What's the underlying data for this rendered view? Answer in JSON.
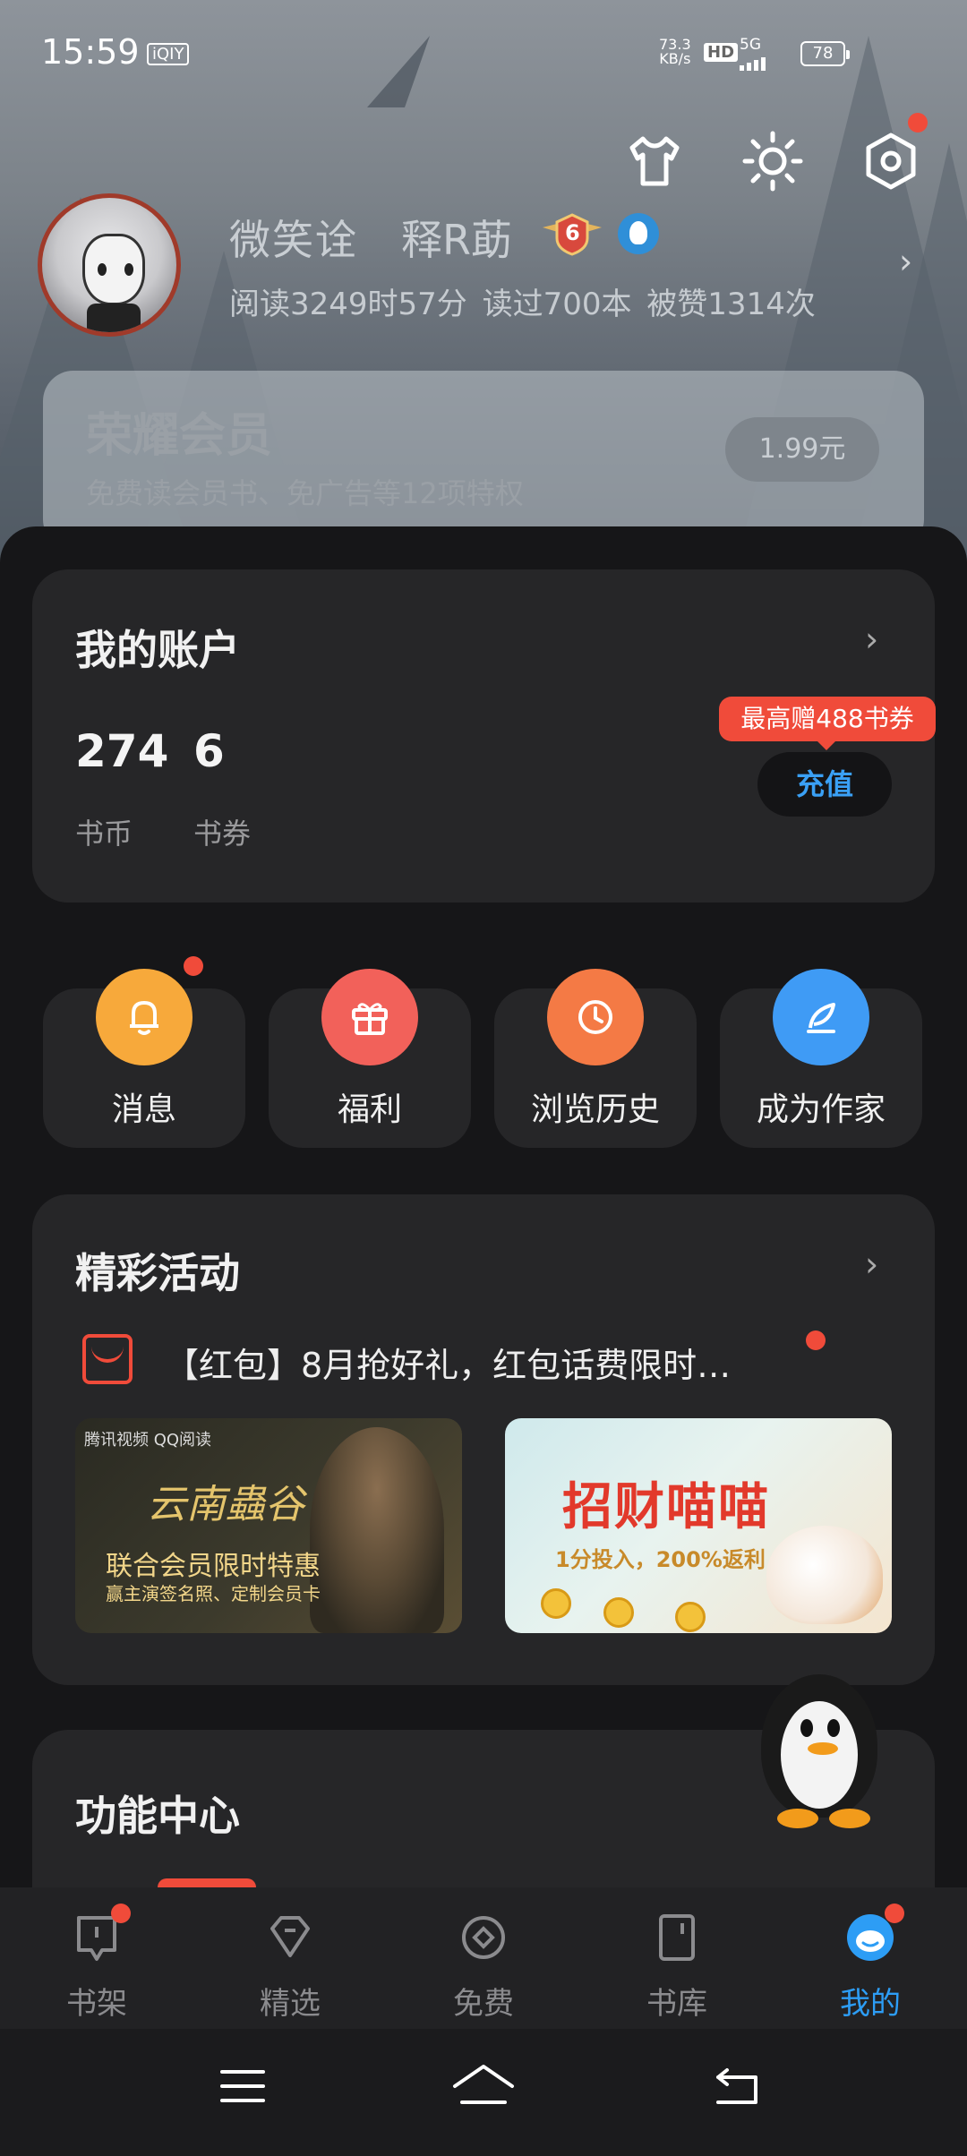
{
  "status_bar": {
    "time": "15:59",
    "app_tag": "iQIY",
    "net_speed": "73.3",
    "net_unit": "KB/s",
    "hd": "HD",
    "signal": "5G",
    "battery": "78"
  },
  "header_icons": [
    "shirt-icon",
    "brightness-icon",
    "settings-icon"
  ],
  "profile": {
    "name_part1": "微笑诠",
    "name_part2": "释R莇",
    "level": "6",
    "stats": "阅读3249时57分 读过700本 被赞1314次"
  },
  "vip": {
    "title": "荣耀会员",
    "subtitle": "免费读会员书、免广告等12项特权",
    "price": "1.99元"
  },
  "account": {
    "title": "我的账户",
    "coins_value": "274",
    "coins_label": "书币",
    "vouchers_value": "6",
    "vouchers_label": "书券",
    "promo_tip": "最高赠488书券",
    "recharge_label": "充值"
  },
  "quick_actions": [
    {
      "label": "消息",
      "icon": "bell-icon",
      "color": "#f7a93b"
    },
    {
      "label": "福利",
      "icon": "gift-icon",
      "color": "#f2615a"
    },
    {
      "label": "浏览历史",
      "icon": "clock-icon",
      "color": "#f47a45"
    },
    {
      "label": "成为作家",
      "icon": "feather-icon",
      "color": "#3f9bf5"
    }
  ],
  "activities": {
    "title": "精彩活动",
    "headline": "【红包】8月抢好礼，红包话费限时…",
    "banner1": {
      "logos": "腾讯视频  QQ阅读",
      "title": "云南蟲谷",
      "line1": "联合会员限时特惠",
      "line2": "赢主演签名照、定制会员卡"
    },
    "banner2": {
      "title": "招财喵喵",
      "subtitle": "1分投入，200%返利"
    }
  },
  "features": {
    "title": "功能中心"
  },
  "tabbar": [
    {
      "label": "书架",
      "icon": "bookshelf-icon"
    },
    {
      "label": "精选",
      "icon": "featured-icon"
    },
    {
      "label": "免费",
      "icon": "free-icon"
    },
    {
      "label": "书库",
      "icon": "library-icon"
    },
    {
      "label": "我的",
      "icon": "me-icon"
    }
  ],
  "colors": {
    "accent_blue": "#2d9df5",
    "badge_red": "#f04b3a"
  }
}
